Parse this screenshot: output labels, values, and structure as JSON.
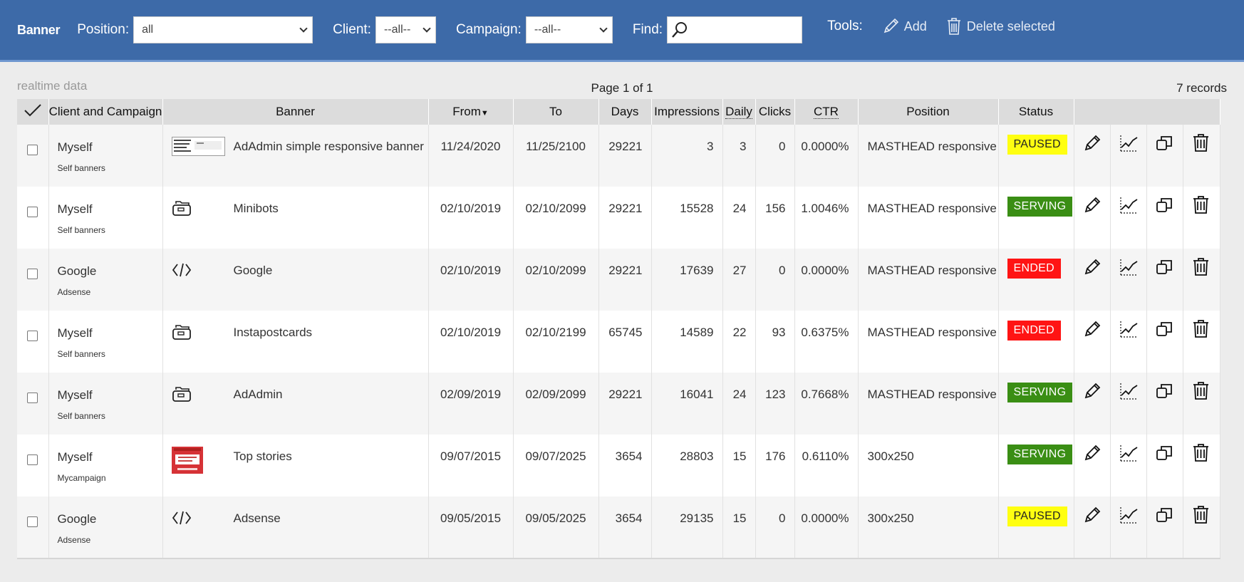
{
  "header": {
    "brand": "Banner",
    "position_label": "Position:",
    "position_value": "all",
    "client_label": "Client:",
    "client_value": "--all--",
    "campaign_label": "Campaign:",
    "campaign_value": "--all--",
    "find_label": "Find:",
    "tools_label": "Tools:",
    "add_label": "Add",
    "delete_label": "Delete selected"
  },
  "meta": {
    "realtime": "realtime data",
    "page": "Page 1 of 1",
    "records": "7 records"
  },
  "columns": {
    "client": "Client and Campaign",
    "banner": "Banner",
    "from": "From",
    "to": "To",
    "days": "Days",
    "impressions": "Impressions",
    "daily": "Daily",
    "clicks": "Clicks",
    "ctr": "CTR",
    "position": "Position",
    "status": "Status"
  },
  "rows": [
    {
      "client": "Myself",
      "campaign": "Self banners",
      "thumb": "image-wide",
      "banner": "AdAdmin simple responsive banner",
      "from": "11/24/2020",
      "to": "11/25/2100",
      "days": "29221",
      "impressions": "3",
      "daily": "3",
      "clicks": "0",
      "ctr": "0.0000%",
      "position": "MASTHEAD responsive",
      "status": "PAUSED",
      "status_type": "paused"
    },
    {
      "client": "Myself",
      "campaign": "Self banners",
      "thumb": "folder-icon",
      "banner": "Minibots",
      "from": "02/10/2019",
      "to": "02/10/2099",
      "days": "29221",
      "impressions": "15528",
      "daily": "24",
      "clicks": "156",
      "ctr": "1.0046%",
      "position": "MASTHEAD responsive",
      "status": "SERVING",
      "status_type": "serving"
    },
    {
      "client": "Google",
      "campaign": "Adsense",
      "thumb": "code-icon",
      "banner": "Google",
      "from": "02/10/2019",
      "to": "02/10/2099",
      "days": "29221",
      "impressions": "17639",
      "daily": "27",
      "clicks": "0",
      "ctr": "0.0000%",
      "position": "MASTHEAD responsive",
      "status": "ENDED",
      "status_type": "ended"
    },
    {
      "client": "Myself",
      "campaign": "Self banners",
      "thumb": "folder-icon",
      "banner": "Instapostcards",
      "from": "02/10/2019",
      "to": "02/10/2199",
      "days": "65745",
      "impressions": "14589",
      "daily": "22",
      "clicks": "93",
      "ctr": "0.6375%",
      "position": "MASTHEAD responsive",
      "status": "ENDED",
      "status_type": "ended"
    },
    {
      "client": "Myself",
      "campaign": "Self banners",
      "thumb": "folder-icon",
      "banner": "AdAdmin",
      "from": "02/09/2019",
      "to": "02/09/2099",
      "days": "29221",
      "impressions": "16041",
      "daily": "24",
      "clicks": "123",
      "ctr": "0.7668%",
      "position": "MASTHEAD responsive",
      "status": "SERVING",
      "status_type": "serving"
    },
    {
      "client": "Myself",
      "campaign": "Mycampaign",
      "thumb": "image-red",
      "banner": "Top stories",
      "from": "09/07/2015",
      "to": "09/07/2025",
      "days": "3654",
      "impressions": "28803",
      "daily": "15",
      "clicks": "176",
      "ctr": "0.6110%",
      "position": "300x250",
      "status": "SERVING",
      "status_type": "serving"
    },
    {
      "client": "Google",
      "campaign": "Adsense",
      "thumb": "code-icon",
      "banner": "Adsense",
      "from": "09/05/2015",
      "to": "09/05/2025",
      "days": "3654",
      "impressions": "29135",
      "daily": "15",
      "clicks": "0",
      "ctr": "0.0000%",
      "position": "300x250",
      "status": "PAUSED",
      "status_type": "paused"
    }
  ],
  "colors": {
    "header_bg": "#3d6aa8",
    "paused": "#ffff11",
    "serving": "#3a8e14",
    "ended": "#ff1414"
  }
}
